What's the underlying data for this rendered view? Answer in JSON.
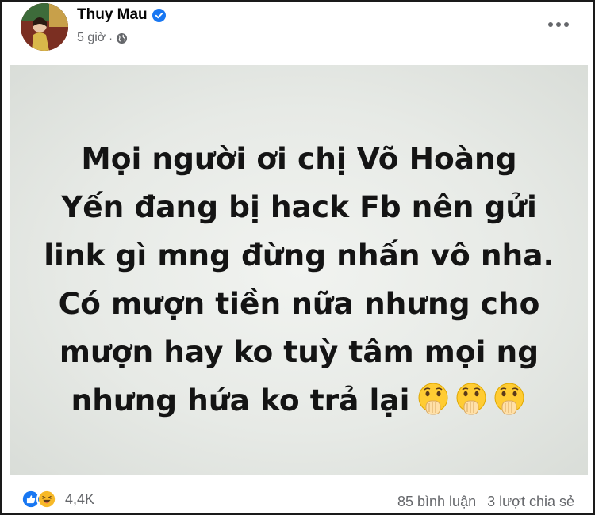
{
  "post": {
    "author": "Thuy Mau",
    "time": "5 giờ",
    "separator": "·",
    "lines": [
      "Mọi người ơi chị Võ Hoàng",
      "Yến đang bị hack Fb nên gửi",
      "link gì mng đừng nhấn vô nha.",
      "Có mượn tiền nữa nhưng cho",
      "mượn hay ko tuỳ tâm mọi ng",
      "nhưng hứa ko trả lại"
    ],
    "emoji_names": [
      "hand-over-mouth-emoji",
      "hand-over-mouth-emoji",
      "hand-over-mouth-emoji"
    ]
  },
  "footer": {
    "reaction_icons": [
      "like-icon",
      "haha-icon"
    ],
    "reaction_count": "4,4K",
    "comments": "85 bình luận",
    "shares": "3 lượt chia sẻ"
  },
  "colors": {
    "like_blue": "#1877f2",
    "haha_yellow": "#f7b928",
    "text_secondary": "#65676b",
    "post_background": "#e7eae6"
  }
}
